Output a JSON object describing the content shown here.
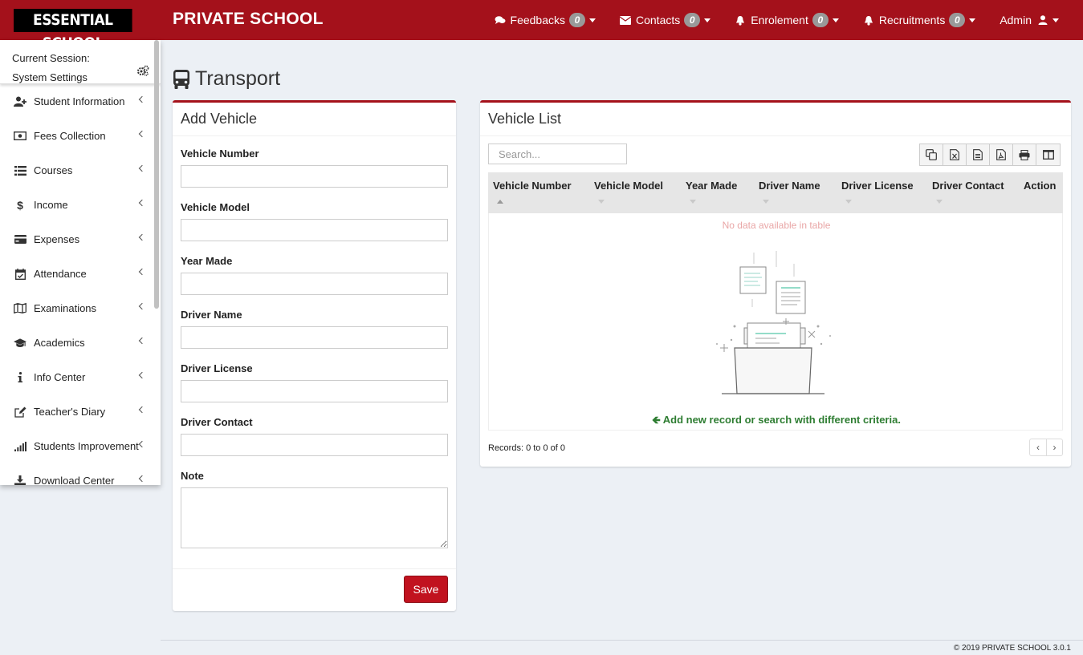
{
  "logo": "ESSENTIAL SCHOOL",
  "brand": "PRIVATE SCHOOL",
  "nav": [
    {
      "label": "Feedbacks",
      "count": "0",
      "icon": "comments-icon"
    },
    {
      "label": "Contacts",
      "count": "0",
      "icon": "envelope-icon"
    },
    {
      "label": "Enrolement",
      "count": "0",
      "icon": "bell-icon"
    },
    {
      "label": "Recruitments",
      "count": "0",
      "icon": "bell-icon"
    }
  ],
  "admin": {
    "label": "Admin",
    "icon": "user-icon"
  },
  "session": {
    "line1": "Current Session:",
    "line2": "System Settings",
    "icon": "gears-icon"
  },
  "sidebar": {
    "items": [
      {
        "label": "Student Information",
        "icon": "user-plus-icon"
      },
      {
        "label": "Fees Collection",
        "icon": "money-icon"
      },
      {
        "label": "Courses",
        "icon": "list-icon"
      },
      {
        "label": "Income",
        "icon": "dollar-icon"
      },
      {
        "label": "Expenses",
        "icon": "credit-card-icon"
      },
      {
        "label": "Attendance",
        "icon": "calendar-check-icon"
      },
      {
        "label": "Examinations",
        "icon": "map-icon"
      },
      {
        "label": "Academics",
        "icon": "graduation-cap-icon"
      },
      {
        "label": "Info Center",
        "icon": "info-icon"
      },
      {
        "label": "Teacher's Diary",
        "icon": "edit-icon"
      },
      {
        "label": "Students Improvement",
        "icon": "signal-icon"
      },
      {
        "label": "Download Center",
        "icon": "download-icon"
      }
    ]
  },
  "page": {
    "title": "Transport",
    "icon": "bus-icon"
  },
  "add_vehicle": {
    "title": "Add Vehicle",
    "fields": {
      "vehicle_number": {
        "label": "Vehicle Number",
        "value": ""
      },
      "vehicle_model": {
        "label": "Vehicle Model",
        "value": ""
      },
      "year_made": {
        "label": "Year Made",
        "value": ""
      },
      "driver_name": {
        "label": "Driver Name",
        "value": ""
      },
      "driver_license": {
        "label": "Driver License",
        "value": ""
      },
      "driver_contact": {
        "label": "Driver Contact",
        "value": ""
      },
      "note": {
        "label": "Note",
        "value": ""
      }
    },
    "save_label": "Save"
  },
  "vehicle_list": {
    "title": "Vehicle List",
    "search_placeholder": "Search...",
    "tools": [
      "copy-icon",
      "excel-icon",
      "csv-icon",
      "pdf-icon",
      "print-icon",
      "columns-icon"
    ],
    "columns": [
      "Vehicle Number",
      "Vehicle Model",
      "Year Made",
      "Driver Name",
      "Driver License",
      "Driver Contact",
      "Action"
    ],
    "empty_text": "No data available in table",
    "hint": "Add new record or search with different criteria.",
    "records": "Records: 0 to 0 of 0",
    "prev": "‹",
    "next": "›"
  },
  "footer": "© 2019 PRIVATE SCHOOL 3.0.1",
  "colors": {
    "brand": "#a4111b",
    "save": "#c1121f",
    "hint": "#2e7d32",
    "empty": "#e9a6a6"
  }
}
